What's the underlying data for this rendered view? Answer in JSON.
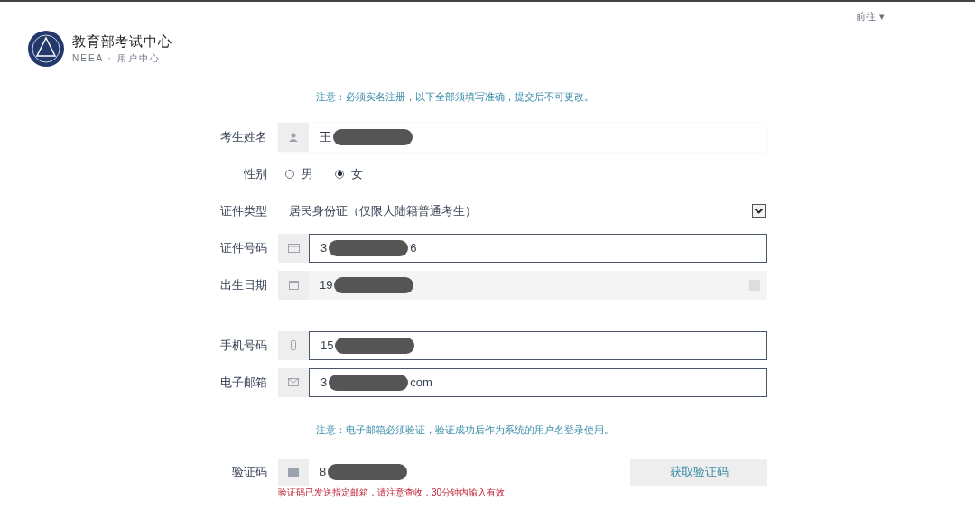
{
  "header": {
    "logo_title": "教育部考试中心",
    "logo_subtitle": "NEEA · 用户中心",
    "menu": {
      "label": "前往",
      "caret": "▾"
    }
  },
  "top_note": "注意：必须实名注册，以下全部须填写准确，提交后不可更改。",
  "fields": [
    {
      "kind": "name",
      "label": "考生姓名",
      "value": "王",
      "redacted": true
    },
    {
      "kind": "gender",
      "label": "性别",
      "options": [
        {
          "label": "男",
          "selected": false
        },
        {
          "label": "女",
          "selected": true
        }
      ]
    },
    {
      "kind": "id-type",
      "label": "证件类型",
      "value": "居民身份证（仅限大陆籍普通考生）"
    },
    {
      "kind": "id-number",
      "label": "证件号码",
      "value": "3",
      "redacted": true,
      "value_end": "6"
    },
    {
      "kind": "birth",
      "label": "出生日期",
      "value": "19",
      "redacted": true
    },
    {
      "kind": "phone",
      "label": "手机号码",
      "value": "15",
      "redacted": true
    },
    {
      "kind": "email",
      "label": "电子邮箱",
      "value": "3",
      "redacted": true,
      "value_end": "com"
    }
  ],
  "email_note": "注意：电子邮箱必须验证，验证成功后作为系统的用户名登录使用。",
  "captcha": {
    "label": "验证码",
    "value": "8",
    "redacted": true,
    "button": "获取验证码",
    "message": "验证码已发送指定邮箱，请注意查收，30分钟内输入有效"
  }
}
